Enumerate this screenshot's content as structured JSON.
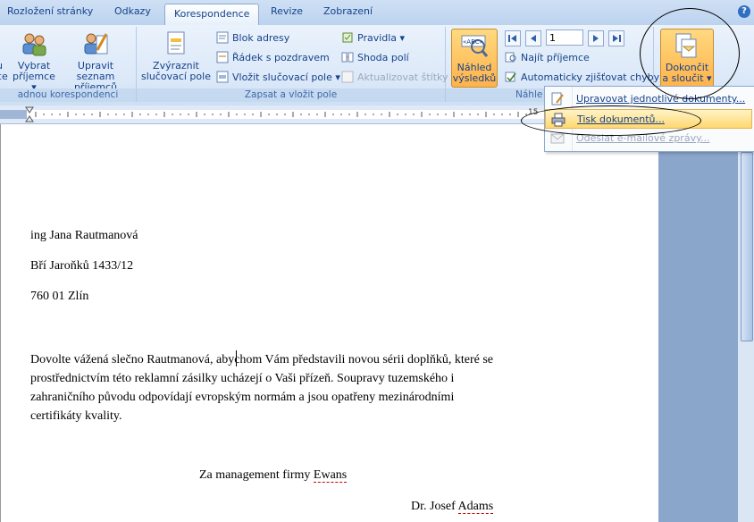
{
  "tabs": [
    {
      "label": "Rozložení stránky"
    },
    {
      "label": "Odkazy"
    },
    {
      "label": "Korespondence"
    },
    {
      "label": "Revize"
    },
    {
      "label": "Zobrazení"
    }
  ],
  "help_icon": "?",
  "ribbon": {
    "group1": {
      "partial_btn": {
        "l1": "u",
        "l2": "ce"
      },
      "select_btn": {
        "l1": "Vybrat",
        "l2": "příjemce"
      },
      "edit_btn": {
        "l1": "Upravit seznam",
        "l2": "příjemců"
      },
      "label": "adnou korespondenci"
    },
    "group2": {
      "highlight_btn": {
        "l1": "Zvýraznit",
        "l2": "slučovací pole"
      },
      "address_block": "Blok adresy",
      "greeting_line": "Řádek s pozdravem",
      "insert_field": "Vložit slučovací pole",
      "rules": "Pravidla",
      "match_fields": "Shoda polí",
      "update_labels": "Aktualizovat štítky",
      "label": "Zapsat a vložit pole"
    },
    "group3": {
      "preview_btn": {
        "l1": "Náhled",
        "l2": "výsledků"
      },
      "abc": "«ABC»",
      "record_value": "1",
      "find_recipient": "Najít příjemce",
      "auto_check": "Automaticky zjišťovat chyby",
      "label": "Náhle"
    },
    "group4": {
      "finish_btn": {
        "l1": "Dokončit",
        "l2": "a sloučit"
      }
    }
  },
  "ruler": {
    "label": "15"
  },
  "menu": {
    "items": [
      {
        "label": "Upravovat jednotlivé dokumenty..."
      },
      {
        "label": "Tisk dokumentů..."
      },
      {
        "label": "Odeslat e-mailové zprávy..."
      }
    ]
  },
  "document": {
    "name_line": "ing Jana Rautmanová",
    "street_line": "Bří Jaroňků  1433/12",
    "city_line": "760 01 Zlín",
    "para1": "Dovolte vážená slečno Rautmanová, abychom Vám představili novou sérii  doplňků, které se",
    "para2": "prostřednictvím této reklamní  zásilky  ucházejí o Vaši přízeň.  Soupravy tuzemského i",
    "para3": "zahraničního původu odpovídají evropským normám  a jsou opatřeny mezinárodními",
    "para4": "certifikáty kvality.",
    "signoff_prefix": "Za management  firmy ",
    "signoff_company": "Ewans",
    "signer_prefix": "Dr. Josef ",
    "signer_name": "Adams"
  },
  "colors": {
    "accent": "#15428b",
    "highlight": "#ffb24a",
    "ribbon_bg": "#dbe8f8"
  }
}
